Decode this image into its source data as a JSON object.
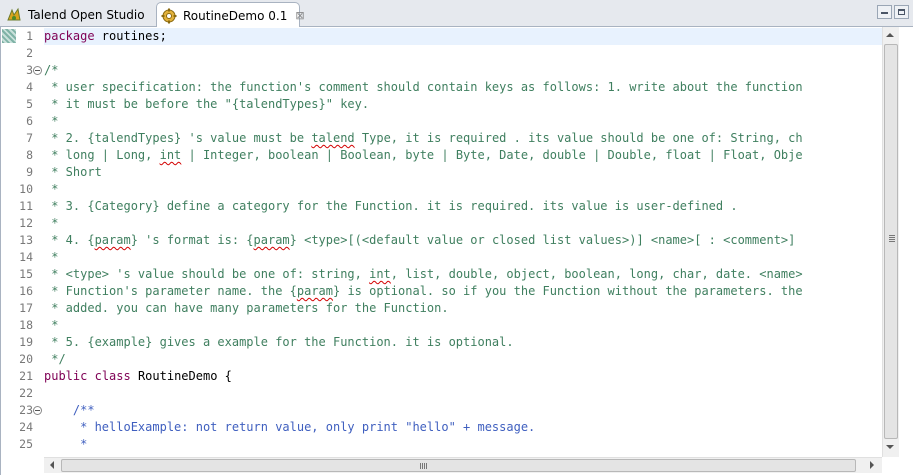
{
  "tabs": [
    {
      "label": "Talend Open Studio",
      "icon": "talend-icon"
    },
    {
      "label": "RoutineDemo 0.1",
      "icon": "routine-icon",
      "close": "⊠"
    }
  ],
  "line_numbers": [
    "1",
    "2",
    "3",
    "4",
    "5",
    "6",
    "7",
    "8",
    "9",
    "10",
    "11",
    "12",
    "13",
    "14",
    "15",
    "16",
    "17",
    "18",
    "19",
    "20",
    "21",
    "22",
    "23",
    "24",
    "25"
  ],
  "code": {
    "l1_kw": "package",
    "l1_rest": " routines;",
    "l3": "/*",
    "l4": " * user specification: the function's comment should contain keys as follows: 1. write about the function",
    "l5": " * it must be before the \"{talendTypes}\" key.",
    "l6": " *",
    "l7a": " * 2. {talendTypes} 's value must be ",
    "l7b": "talend",
    "l7c": " Type, it is required . its value should be one of: String, ch",
    "l8a": " * long | Long, ",
    "l8b": "int",
    "l8c": " | Integer, boolean | Boolean, byte | Byte, Date, double | Double, float | Float, Obje",
    "l9": " * Short",
    "l10": " *",
    "l11": " * 3. {Category} define a category for the Function. it is required. its value is user-defined .",
    "l12": " *",
    "l13a": " * 4. {",
    "l13b": "param",
    "l13c": "} 's format is: {",
    "l13d": "param",
    "l13e": "} <type>[(<default value or closed list values>)] <name>[ : <comment>]",
    "l14": " *",
    "l15a": " * <type> 's value should be one of: string, ",
    "l15b": "int",
    "l15c": ", list, double, object, boolean, long, char, date. <name>",
    "l16a": " * Function's parameter name. the {",
    "l16b": "param",
    "l16c": "} is optional. so if you the Function without the parameters. the",
    "l17": " * added. you can have many parameters for the Function.",
    "l18": " *",
    "l19": " * 5. {example} gives a example for the Function. it is optional.",
    "l20": " */",
    "l21_kw1": "public",
    "l21_kw2": "class",
    "l21_rest": " RoutineDemo {",
    "l23": "    /**",
    "l24": "     * helloExample: not return value, only print \"hello\" + message.",
    "l25": "     *"
  },
  "colors": {
    "keyword": "#7f0055",
    "comment": "#3f7f5f",
    "javadoc": "#3f5fbf",
    "current_line": "#e8f2fe"
  }
}
